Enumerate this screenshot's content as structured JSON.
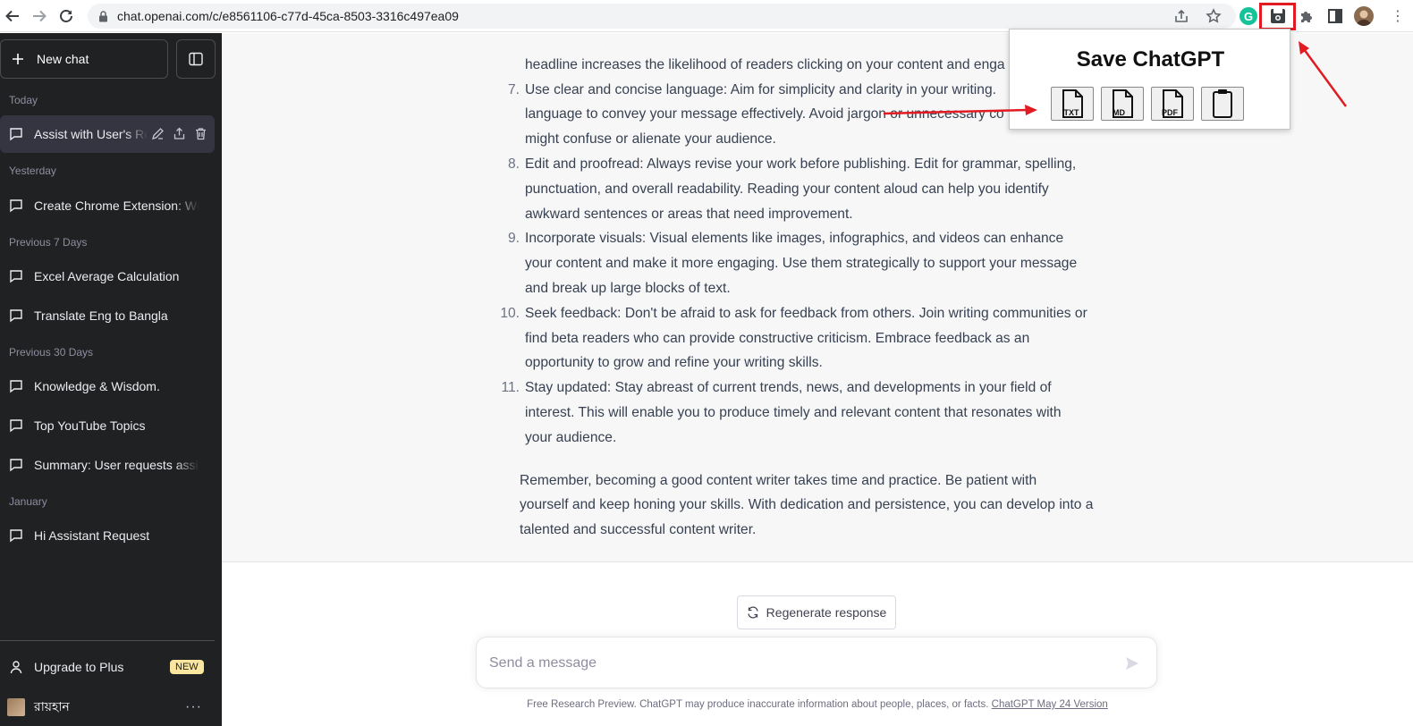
{
  "browser": {
    "url": "chat.openai.com/c/e8561106-c77d-45ca-8503-3316c497ea09"
  },
  "sidebar": {
    "new_chat": "New chat",
    "sections": [
      {
        "label": "Today"
      },
      {
        "label": "Yesterday"
      },
      {
        "label": "Previous 7 Days"
      },
      {
        "label": "Previous 30 Days"
      },
      {
        "label": "January"
      }
    ],
    "chats": [
      {
        "label": "Assist with User's Re"
      },
      {
        "label": "Create Chrome Extension: We"
      },
      {
        "label": "Excel Average Calculation"
      },
      {
        "label": "Translate Eng to Bangla"
      },
      {
        "label": "Knowledge & Wisdom."
      },
      {
        "label": "Top YouTube Topics"
      },
      {
        "label": "Summary: User requests assist"
      },
      {
        "label": "Hi Assistant Request"
      }
    ],
    "upgrade": "Upgrade to Plus",
    "badge": "NEW",
    "user_name": "রায়হান"
  },
  "conversation": {
    "partial_lines": [
      "headline increases the likelihood of readers clicking on your content and enga"
    ],
    "items": [
      {
        "num": "7.",
        "lines": [
          "Use clear and concise language: Aim for simplicity and clarity in your writing.",
          "language to convey your message effectively. Avoid jargon or unnecessary co",
          "might confuse or alienate your audience."
        ]
      },
      {
        "num": "8.",
        "lines": [
          "Edit and proofread: Always revise your work before publishing. Edit for grammar, spelling,",
          "punctuation, and overall readability. Reading your content aloud can help you identify",
          "awkward sentences or areas that need improvement."
        ]
      },
      {
        "num": "9.",
        "lines": [
          "Incorporate visuals: Visual elements like images, infographics, and videos can enhance",
          "your content and make it more engaging. Use them strategically to support your message",
          "and break up large blocks of text."
        ]
      },
      {
        "num": "10.",
        "lines": [
          "Seek feedback: Don't be afraid to ask for feedback from others. Join writing communities or",
          "find beta readers who can provide constructive criticism. Embrace feedback as an",
          "opportunity to grow and refine your writing skills."
        ]
      },
      {
        "num": "11.",
        "lines": [
          "Stay updated: Stay abreast of current trends, news, and developments in your field of",
          "interest. This will enable you to produce timely and relevant content that resonates with",
          "your audience."
        ]
      }
    ],
    "closing": [
      "Remember, becoming a good content writer takes time and practice. Be patient with",
      "yourself and keep honing your skills. With dedication and persistence, you can develop into a",
      "talented and successful content writer."
    ]
  },
  "composer": {
    "regenerate": "Regenerate response",
    "placeholder": "Send a message",
    "footnote": "Free Research Preview. ChatGPT may produce inaccurate information about people, places, or facts.",
    "footnote_link": "ChatGPT May 24 Version"
  },
  "popup": {
    "title": "Save ChatGPT",
    "buttons": [
      {
        "label": "TXT"
      },
      {
        "label": "MD"
      },
      {
        "label": "PDF"
      },
      {
        "label": ""
      }
    ]
  },
  "colors": {
    "sidebar_bg": "#202123",
    "active_chat_bg": "#343541",
    "highlight_red": "#e21b22",
    "badge_bg": "#fae69e",
    "grammarly_green": "#15c39a"
  },
  "icons": [
    "back-arrow-icon",
    "forward-arrow-icon",
    "reload-icon",
    "lock-icon",
    "share-icon",
    "star-icon",
    "grammarly-icon",
    "save-chatgpt-extension-icon",
    "puzzle-icon",
    "side-panel-icon",
    "profile-icon",
    "menu-icon",
    "plus-icon",
    "sidebar-toggle-icon",
    "chat-bubble-icon",
    "pencil-icon",
    "export-icon",
    "trash-icon",
    "user-icon",
    "regenerate-icon",
    "send-icon",
    "file-txt-icon",
    "file-md-icon",
    "file-pdf-icon",
    "clipboard-icon"
  ]
}
